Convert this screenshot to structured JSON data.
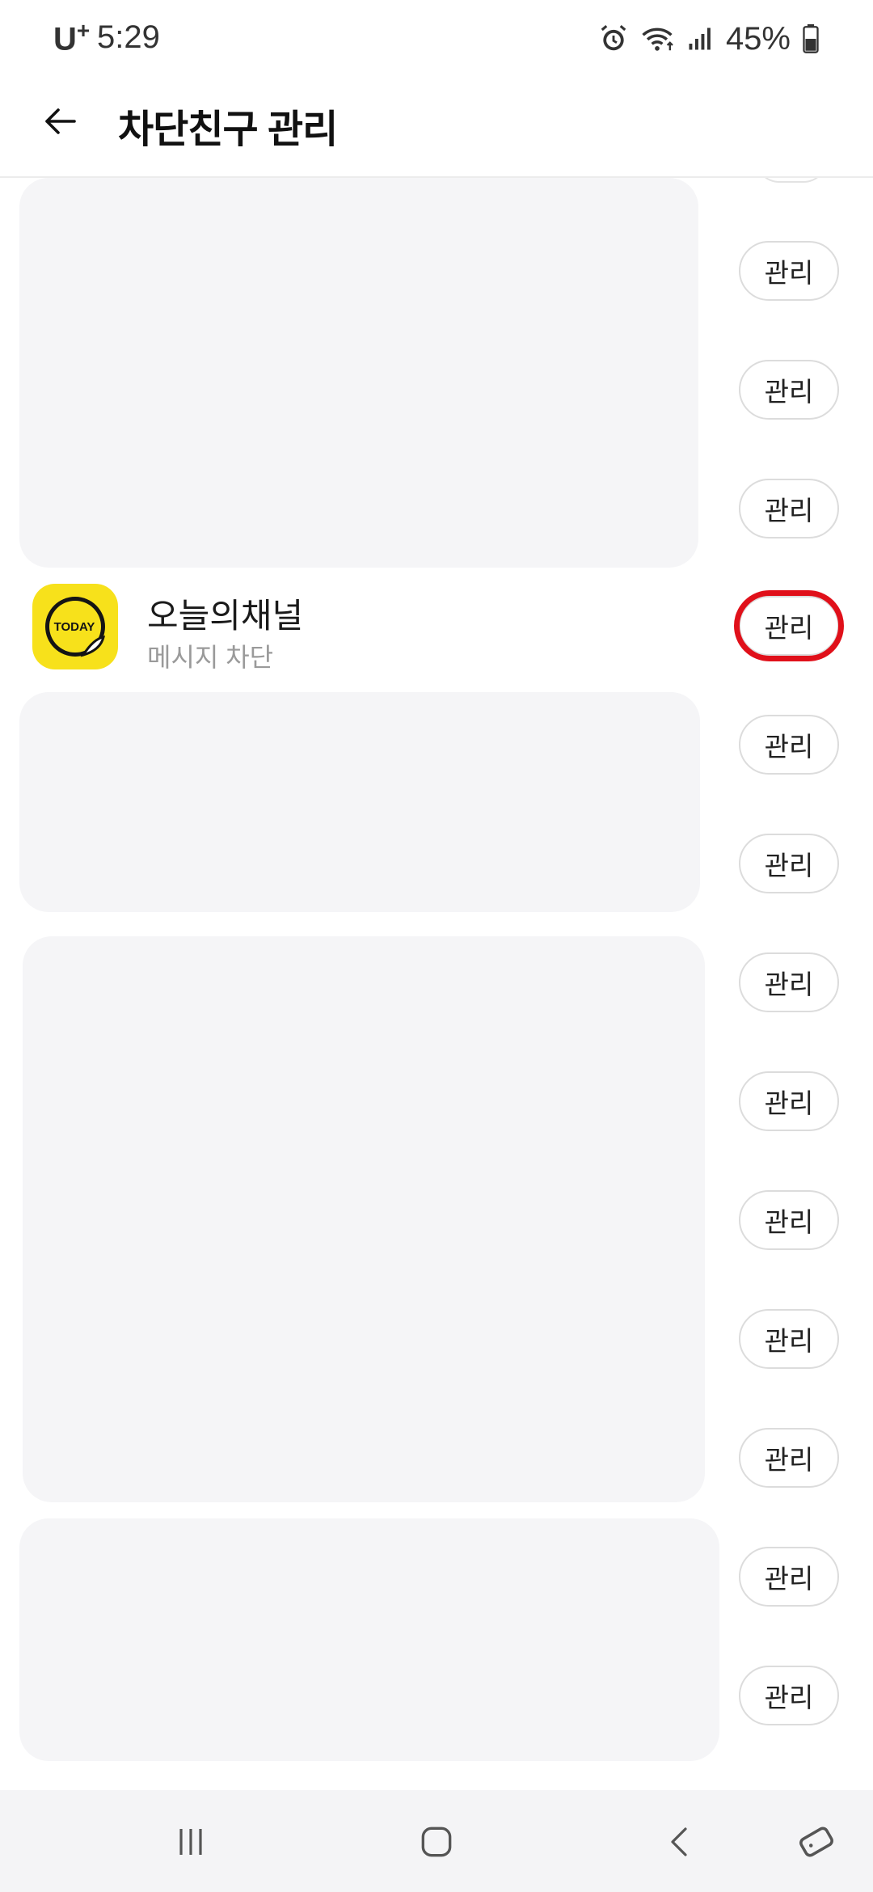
{
  "status_bar": {
    "carrier": "U",
    "carrier_plus": "+",
    "time": "5:29",
    "battery_percent": "45%",
    "icons": [
      "alarm-icon",
      "wifi-icon",
      "signal-icon",
      "battery-icon"
    ]
  },
  "header": {
    "title": "차단친구 관리",
    "back_icon": "back-arrow-icon"
  },
  "channel": {
    "name": "오늘의채널",
    "subtitle": "메시지 차단",
    "logo_text": "TODAY",
    "logo_color": "#f7e11b"
  },
  "manage_label": "관리",
  "manage_buttons": [
    "관리",
    "관리",
    "관리",
    "관리",
    "관리",
    "관리",
    "관리",
    "관리",
    "관리",
    "관리",
    "관리",
    "관리",
    "관리"
  ],
  "highlight_color": "#e0101a",
  "nav_bar": {
    "icons": [
      "recent-apps-icon",
      "home-icon",
      "back-icon",
      "rotate-icon"
    ]
  }
}
